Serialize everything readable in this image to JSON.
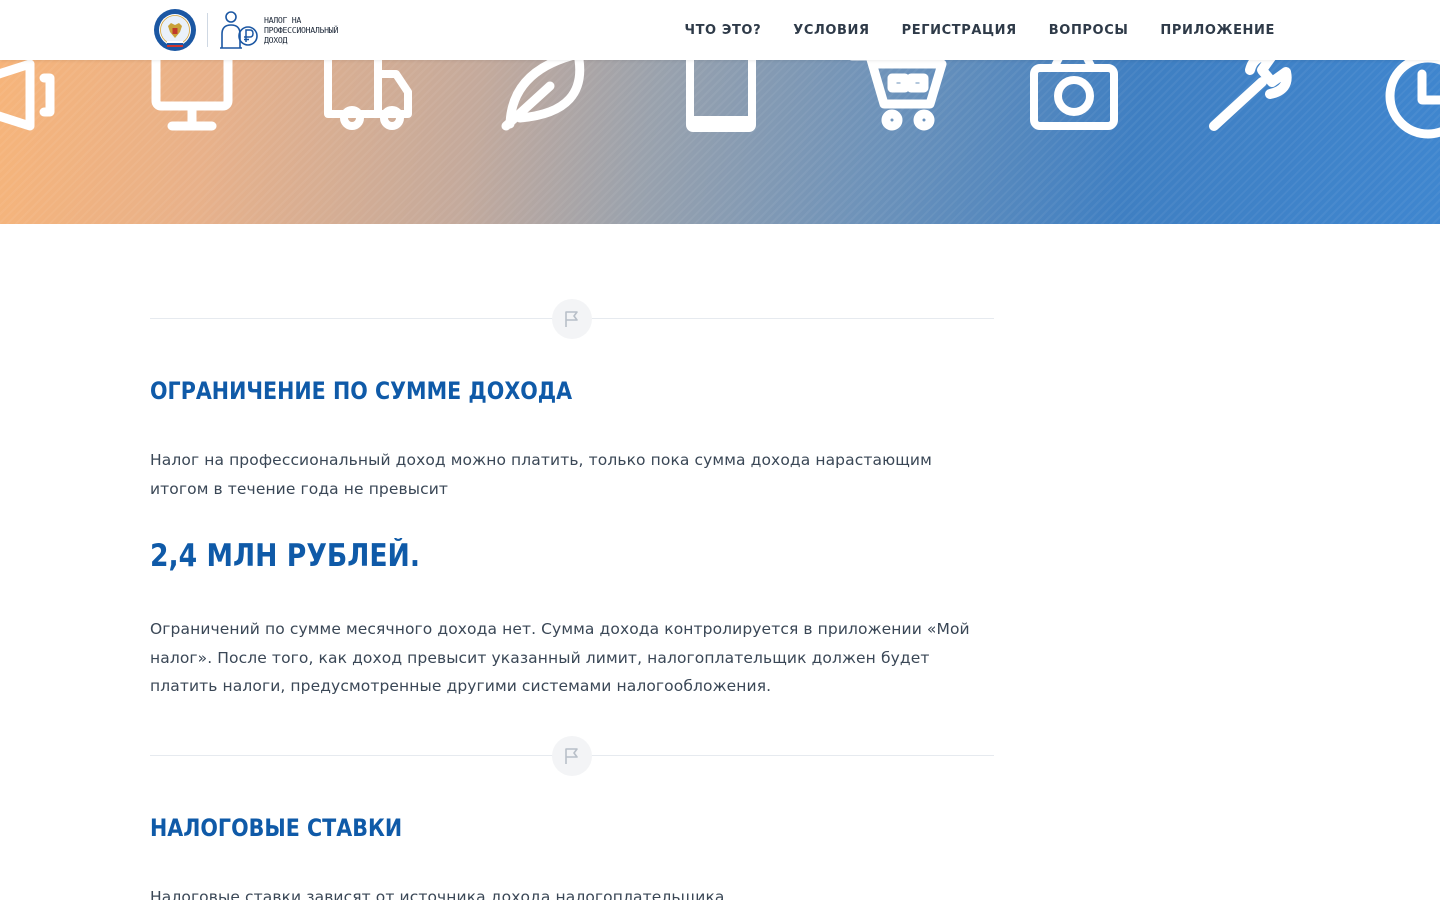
{
  "header": {
    "logo_text": "НАЛОГ НА ПРОФЕССИОНАЛЬНЫЙ ДОХОД",
    "nav": [
      {
        "label": "ЧТО ЭТО?"
      },
      {
        "label": "УСЛОВИЯ"
      },
      {
        "label": "РЕГИСТРАЦИЯ"
      },
      {
        "label": "ВОПРОСЫ"
      },
      {
        "label": "ПРИЛОЖЕНИЕ"
      }
    ]
  },
  "banner": {
    "icons": [
      "megaphone-icon",
      "monitor-icon",
      "truck-icon",
      "leaf-icon",
      "book-icon",
      "cart-icon",
      "camera-icon",
      "wrench-icon",
      "clock-icon"
    ]
  },
  "sections": {
    "income_limit": {
      "title": "ОГРАНИЧЕНИЕ ПО СУММЕ ДОХОДА",
      "intro": "Налог на профессиональный доход можно платить, только пока сумма дохода нарастающим итогом в течение года не превысит",
      "limit": "2,4 МЛН РУБЛЕЙ.",
      "details": "Ограничений по сумме месячного дохода нет. Сумма дохода контролируется в приложении «Мой налог». После того, как доход превысит указанный лимит, налогоплательщик должен будет платить налоги, предусмотренные другими системами налогообложения."
    },
    "tax_rates": {
      "title": "НАЛОГОВЫЕ СТАВКИ",
      "intro": "Налоговые ставки зависят от источника дохода налогоплательщика"
    }
  },
  "colors": {
    "accent": "#0f5aa8",
    "text": "#3a4756",
    "divider": "#e6eaef"
  }
}
